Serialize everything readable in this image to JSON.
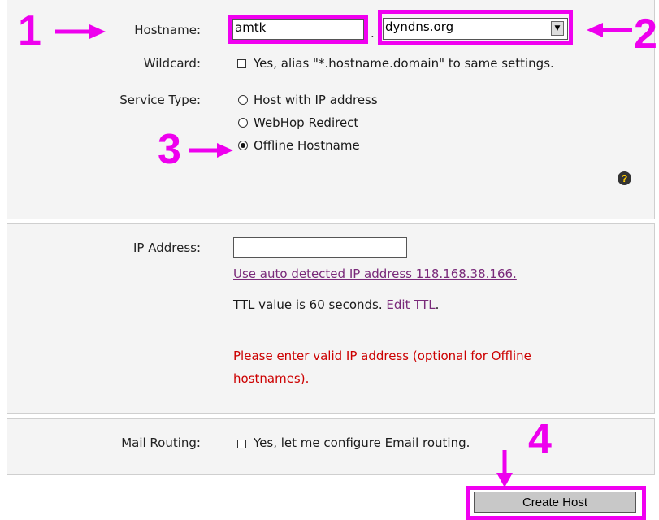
{
  "hostname": {
    "label": "Hostname:",
    "value": "amtk",
    "separator": ".",
    "domain_selected": "dyndns.org"
  },
  "wildcard": {
    "label": "Wildcard:",
    "option": "Yes, alias \"*.hostname.domain\" to same settings.",
    "checked": false
  },
  "service_type": {
    "label": "Service Type:",
    "options": [
      "Host with IP address",
      "WebHop Redirect",
      "Offline Hostname"
    ],
    "selected": "Offline Hostname"
  },
  "ip": {
    "label": "IP Address:",
    "value": "",
    "auto_detect_link": "Use auto detected IP address 118.168.38.166.",
    "ttl_text": "TTL value is 60 seconds.",
    "ttl_link": "Edit TTL",
    "ttl_suffix": ".",
    "error_line1": "Please enter valid IP address (optional for Offline",
    "error_line2": "hostnames)."
  },
  "mail": {
    "label": "Mail Routing:",
    "option": "Yes, let me configure Email routing.",
    "checked": false
  },
  "create_button": "Create Host",
  "help_icon_glyph": "?",
  "annotations": [
    "1",
    "2",
    "3",
    "4"
  ],
  "colors": {
    "highlight": "#f000f0",
    "link": "#7a2a7a",
    "error": "#cc0000",
    "panel_bg": "#f4f4f4"
  }
}
